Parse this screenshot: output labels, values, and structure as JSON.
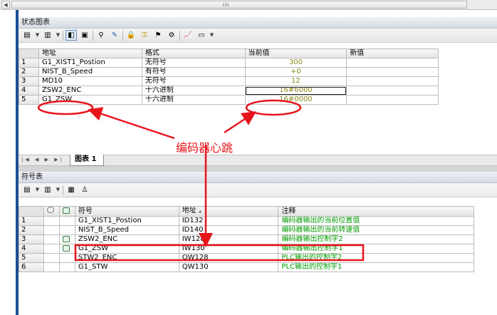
{
  "scrollbar": {
    "grip": "III"
  },
  "status_panel": {
    "title": "状态图表",
    "columns": [
      "地址",
      "格式",
      "当前值",
      "新值"
    ],
    "rows": [
      {
        "n": "1",
        "address": "G1_XIST1_Postion",
        "format": "无符号",
        "value": "300",
        "new": ""
      },
      {
        "n": "2",
        "address": "NIST_B_Speed",
        "format": "有符号",
        "value": "+0",
        "new": ""
      },
      {
        "n": "3",
        "address": "MD10",
        "format": "无符号",
        "value": "12",
        "new": ""
      },
      {
        "n": "4",
        "address": "ZSW2_ENC",
        "format": "十六进制",
        "value": "16#6000",
        "new": ""
      },
      {
        "n": "5",
        "address": "G1_ZSW",
        "format": "十六进制",
        "value": "16#0000",
        "new": ""
      }
    ],
    "tab_label": "图表 1"
  },
  "annotation": {
    "text": "编码器心跳",
    "color": "#e8141b"
  },
  "symbol_panel": {
    "title": "符号表",
    "columns": [
      "符号",
      "地址",
      "注释"
    ],
    "sort_indicator": "▲",
    "rows": [
      {
        "n": "1",
        "symbol": "G1_XIST1_Postion",
        "address": "ID132",
        "comment": "编码器输出的当前位置值",
        "icon": false
      },
      {
        "n": "2",
        "symbol": "NIST_B_Speed",
        "address": "ID140",
        "comment": "编码器输出的当前转速值",
        "icon": false
      },
      {
        "n": "3",
        "symbol": "ZSW2_ENC",
        "address": "IW128",
        "comment": "编码器输出控制字2",
        "icon": true
      },
      {
        "n": "4",
        "symbol": "G1_ZSW",
        "address": "IW130",
        "comment": "编码器输出控制字1",
        "icon": true
      },
      {
        "n": "5",
        "symbol": "STW2_ENC",
        "address": "QW128",
        "comment": "PLC输出的控制字2",
        "icon": false
      },
      {
        "n": "6",
        "symbol": "G1_STW",
        "address": "QW130",
        "comment": "PLC输出的控制字1",
        "icon": false
      }
    ]
  }
}
